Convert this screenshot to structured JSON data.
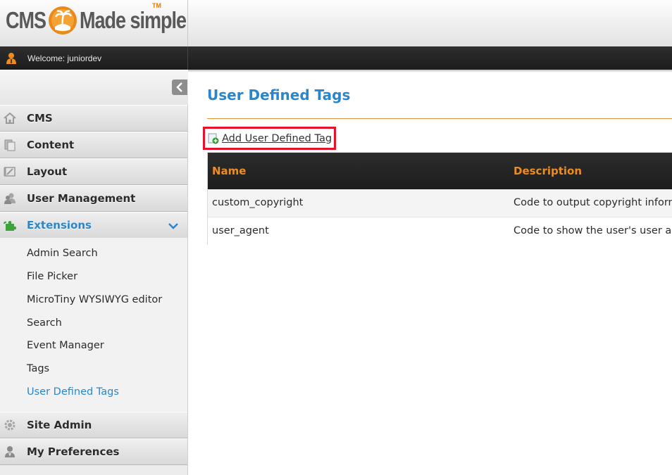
{
  "app": {
    "logo_text_left": "CMS",
    "logo_text_right": "Made simple",
    "logo_tm": "TM",
    "brand_color": "#e07a0d",
    "accent_color": "#2a86cc"
  },
  "userbar": {
    "welcome": "Welcome: juniordev",
    "user_icon": "user-icon"
  },
  "sidebar": {
    "collapse_icon": "chevron-left-icon",
    "items": [
      {
        "label": "CMS",
        "icon": "home-icon"
      },
      {
        "label": "Content",
        "icon": "content-pages-icon"
      },
      {
        "label": "Layout",
        "icon": "layout-icon"
      },
      {
        "label": "User Management",
        "icon": "users-icon"
      },
      {
        "label": "Extensions",
        "icon": "puzzle-icon",
        "active": true,
        "expanded": true
      },
      {
        "label": "Site Admin",
        "icon": "gear-icon"
      },
      {
        "label": "My Preferences",
        "icon": "user-preferences-icon"
      }
    ],
    "submenu": [
      {
        "label": "Admin Search"
      },
      {
        "label": "File Picker"
      },
      {
        "label": "MicroTiny WYSIWYG editor"
      },
      {
        "label": "Search"
      },
      {
        "label": "Event Manager"
      },
      {
        "label": "Tags"
      },
      {
        "label": "User Defined Tags",
        "active": true
      }
    ]
  },
  "main": {
    "title": "User Defined Tags",
    "add_link": " Add User Defined Tag",
    "add_icon": "add-document-icon",
    "table": {
      "headers": [
        "Name",
        "Description"
      ],
      "rows": [
        [
          "custom_copyright",
          "Code to output copyright inform"
        ],
        [
          "user_agent",
          "Code to show the user's user ag"
        ]
      ]
    }
  }
}
